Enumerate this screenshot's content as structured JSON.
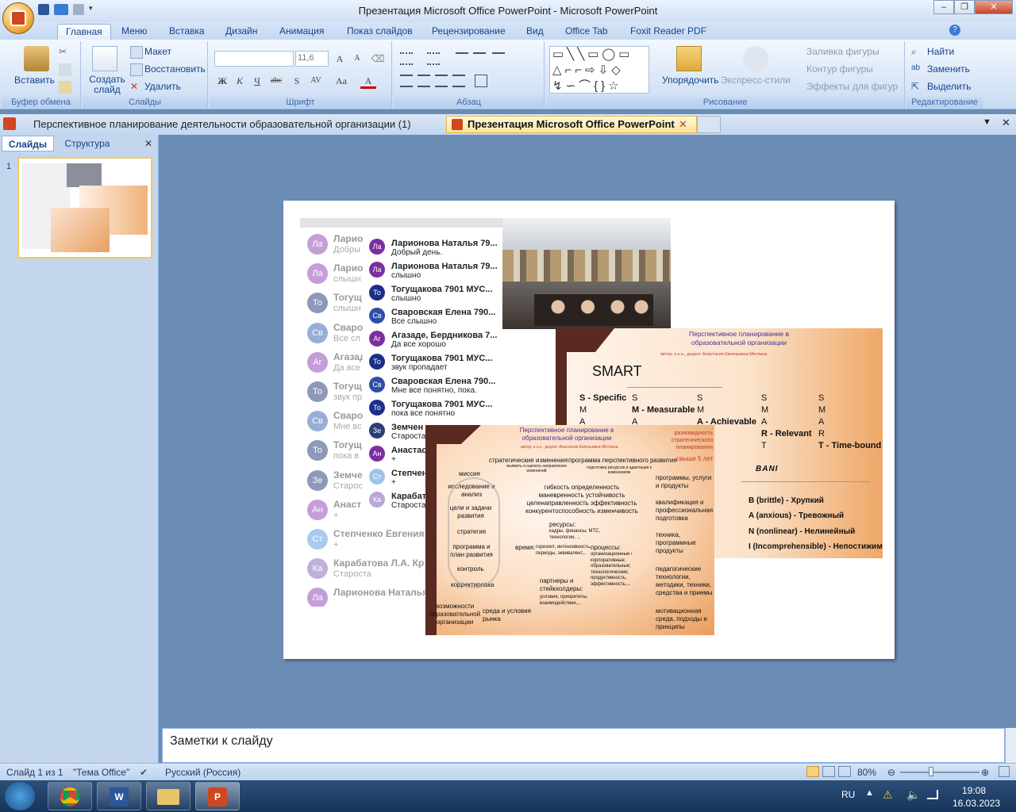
{
  "window": {
    "title": "Презентация Microsoft Office PowerPoint - Microsoft PowerPoint"
  },
  "ribbon_tabs": [
    "Главная",
    "Меню",
    "Вставка",
    "Дизайн",
    "Анимация",
    "Показ слайдов",
    "Рецензирование",
    "Вид",
    "Office Tab",
    "Foxit Reader PDF"
  ],
  "ribbon": {
    "clipboard": {
      "paste": "Вставить",
      "label": "Буфер обмена"
    },
    "slides": {
      "create": "Создать слайд",
      "layout": "Макет",
      "restore": "Восстановить",
      "delete": "Удалить",
      "label": "Слайды"
    },
    "font": {
      "size": "11,6",
      "label": "Шрифт"
    },
    "paragraph": {
      "label": "Абзац"
    },
    "drawing": {
      "arrange": "Упорядочить",
      "styles": "Экспресс-стили",
      "fill": "Заливка фигуры",
      "outline": "Контур фигуры",
      "effects": "Эффекты для фигур",
      "label": "Рисование"
    },
    "editing": {
      "find": "Найти",
      "replace": "Заменить",
      "select": "Выделить",
      "label": "Редактирование"
    }
  },
  "doc_tabs": [
    "Перспективное планирование деятельности образовательной организации (1)",
    "Презентация Microsoft Office PowerPoint"
  ],
  "left_pane": {
    "tabs": [
      "Слайды",
      "Структура"
    ],
    "slide_number": "1"
  },
  "notes": {
    "placeholder": "Заметки к слайду"
  },
  "status": {
    "slide": "Слайд 1 из 1",
    "theme": "\"Тема Office\"",
    "lang": "Русский (Россия)",
    "zoom": "80%"
  },
  "taskbar": {
    "lang": "RU",
    "time": "19:08",
    "date": "16.03.2023"
  },
  "slide": {
    "chat_front": [
      {
        "init": "Ла",
        "name": "Ларионова Наталья 79...",
        "msg": "Добрый день.",
        "color": "#7b2fa0"
      },
      {
        "init": "Ла",
        "name": "Ларионова Наталья 79...",
        "msg": "слышно",
        "color": "#7b2fa0"
      },
      {
        "init": "То",
        "name": "Тогущакова 7901 МУС...",
        "msg": "слышно",
        "color": "#1b2f8a"
      },
      {
        "init": "Св",
        "name": "Сваровская Елена 790...",
        "msg": "Все слышно",
        "color": "#2d4fa8"
      },
      {
        "init": "Аг",
        "name": "Агазаде, Бердникова 7...",
        "msg": "Да все хорошо",
        "color": "#7b2fa0"
      },
      {
        "init": "То",
        "name": "Тогущакова 7901 МУС...",
        "msg": "звук пропадает",
        "color": "#1b2f8a"
      },
      {
        "init": "Св",
        "name": "Сваровская Елена 790...",
        "msg": "Мне все понятно, пока.",
        "color": "#2d4fa8"
      },
      {
        "init": "То",
        "name": "Тогущакова 7901 МУС...",
        "msg": "пока все понятно",
        "color": "#1b2f8a"
      },
      {
        "init": "Зе",
        "name": "Земчен",
        "msg": "Староста",
        "color": "#2a3f7a"
      },
      {
        "init": "Ан",
        "name": "Анастас",
        "msg": "+",
        "color": "#7b2fa0"
      },
      {
        "init": "Ст",
        "name": "Степчен",
        "msg": "+",
        "color": "#9ec3ea"
      },
      {
        "init": "Ка",
        "name": "Карабат",
        "msg": "Староста",
        "color": "#b9a7d6"
      }
    ],
    "chat_back": [
      {
        "init": "Ла",
        "name": "Ларио",
        "msg": "Добры"
      },
      {
        "init": "Ла",
        "name": "Ларио",
        "msg": "слышн"
      },
      {
        "init": "То",
        "name": "Тогущ",
        "msg": "слышн"
      },
      {
        "init": "Св",
        "name": "Сваро",
        "msg": "Все сл"
      },
      {
        "init": "Аг",
        "name": "Агазад",
        "msg": "Да все"
      },
      {
        "init": "То",
        "name": "Тогущ",
        "msg": "звук пр"
      },
      {
        "init": "Св",
        "name": "Сваро",
        "msg": "Мне вс"
      },
      {
        "init": "То",
        "name": "Тогущ",
        "msg": "пока в"
      },
      {
        "init": "Зе",
        "name": "Земче",
        "msg": "Старос"
      },
      {
        "init": "Ан",
        "name": "Анаст",
        "msg": "+"
      },
      {
        "init": "Ст",
        "name": "Степченко Евгения",
        "msg": "+"
      },
      {
        "init": "Ка",
        "name": "Карабатова Л.А. Кр",
        "msg": "Староста"
      },
      {
        "init": "Ла",
        "name": "Ларионова Наталья",
        "msg": ""
      }
    ],
    "smart": {
      "header": "Перспективное планирование в образовательной организации",
      "author": "автор: к.э.н., доцент Анастасия Евгеньевна Метлина",
      "title": "SMART",
      "specific": "S - Specific",
      "measurable": "M - Measurable",
      "achievable": "A - Achievable",
      "relevant": "R - Relevant",
      "timebound": "T - Time-bound",
      "bani": "BANI",
      "b": "B (brittle) - Хрупкий",
      "a": "A (anxious) - Тревожный",
      "n": "N (nonlinear) - Нелинейный",
      "i": "I  (Incomprehensible) - Непостижимый"
    },
    "plan": {
      "header": "Перспективное планирование в образовательной организации",
      "author": "автор: к.э.н., доцент Анастасия Евгеньевна Метлина",
      "levels": "разновидность стратегического планирования",
      "horizon": "свыше 5 лет",
      "strat": "стратегические изменения",
      "strat_sub": "выявить и оценить направления изменений",
      "program": "программа перспективного развития",
      "program_sub": "подготовка ресурсов и адаптация к изменениям",
      "cycle": [
        "миссия",
        "исследование и анализ",
        "цели и задачи развития",
        "стратегия",
        "программа и план развития",
        "контроль",
        "корректировка"
      ],
      "qualities": "гибкость   определенность  маневренность  устойчивость  целенаправленность  эффективность  конкурентоспособность  изменчивость",
      "resources": "ресурсы:",
      "resources_sub": "кадры, финансы, МТС, технологии, ...",
      "time": "время:",
      "time_sub": "горизонт, интенсивность, периоды, эквивалент,..",
      "processes": "процессы:",
      "processes_sub": "организационные / корпоративные; образовательные; технологические; продуктивность, эффективность,...",
      "partners": "партнеры и стейкхолдеры:",
      "partners_sub": "условия, приоритеты, взаимодействие,...",
      "opportunities": "возможности образовательной организации",
      "env": "среда и условия рынка",
      "right": [
        "программы, услуги и продукты",
        "квалификация и профессиональная подготовка",
        "техника, программные продукты",
        "педагогические технологии, методики, техники, средства и приемы",
        "мотивационная среда, подходы и принципы"
      ]
    }
  }
}
